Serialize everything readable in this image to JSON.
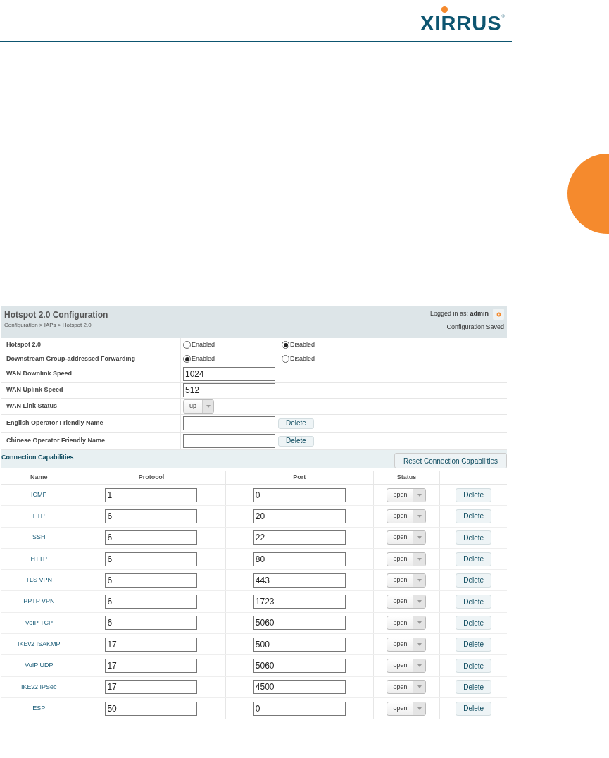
{
  "logo": {
    "text": "XIRRUS",
    "mark": "®"
  },
  "header": {
    "title": "Hotspot 2.0 Configuration",
    "breadcrumb": "Configuration > IAPs > Hotspot 2.0",
    "logged_in_label": "Logged in as:",
    "user": "admin",
    "status": "Configuration Saved"
  },
  "settings": [
    {
      "kind": "radio",
      "label": "Hotspot 2.0",
      "options": [
        {
          "label": "Enabled",
          "selected": false
        },
        {
          "label": "Disabled",
          "selected": true
        }
      ]
    },
    {
      "kind": "radio",
      "label": "Downstream Group-addressed Forwarding",
      "options": [
        {
          "label": "Enabled",
          "selected": true
        },
        {
          "label": "Disabled",
          "selected": false
        }
      ]
    },
    {
      "kind": "input",
      "label": "WAN Downlink Speed",
      "value": "1024"
    },
    {
      "kind": "input",
      "label": "WAN Uplink Speed",
      "value": "512"
    },
    {
      "kind": "select",
      "label": "WAN Link Status",
      "value": "up"
    },
    {
      "kind": "input_delete",
      "label": "English Operator Friendly Name",
      "button": "Delete"
    },
    {
      "kind": "input_delete",
      "label": "Chinese Operator Friendly Name",
      "button": "Delete"
    }
  ],
  "connection_capabilities": {
    "title": "Connection Capabilities",
    "reset_button": "Reset Connection Capabilities",
    "columns": [
      "Name",
      "Protocol",
      "Port",
      "Status"
    ],
    "rows": [
      {
        "name": "ICMP",
        "protocol": "1",
        "port": "0",
        "status": "open",
        "button": "Delete"
      },
      {
        "name": "FTP",
        "protocol": "6",
        "port": "20",
        "status": "open",
        "button": "Delete"
      },
      {
        "name": "SSH",
        "protocol": "6",
        "port": "22",
        "status": "open",
        "button": "Delete"
      },
      {
        "name": "HTTP",
        "protocol": "6",
        "port": "80",
        "status": "open",
        "button": "Delete"
      },
      {
        "name": "TLS VPN",
        "protocol": "6",
        "port": "443",
        "status": "open",
        "button": "Delete"
      },
      {
        "name": "PPTP VPN",
        "protocol": "6",
        "port": "1723",
        "status": "open",
        "button": "Delete"
      },
      {
        "name": "VoIP TCP",
        "protocol": "6",
        "port": "5060",
        "status": "open",
        "button": "Delete"
      },
      {
        "name": "IKEv2 ISAKMP",
        "protocol": "17",
        "port": "500",
        "status": "open",
        "button": "Delete"
      },
      {
        "name": "VoIP UDP",
        "protocol": "17",
        "port": "5060",
        "status": "open",
        "button": "Delete"
      },
      {
        "name": "IKEv2 IPSec",
        "protocol": "17",
        "port": "4500",
        "status": "open",
        "button": "Delete"
      },
      {
        "name": "ESP",
        "protocol": "50",
        "port": "0",
        "status": "open",
        "button": "Delete"
      }
    ]
  }
}
